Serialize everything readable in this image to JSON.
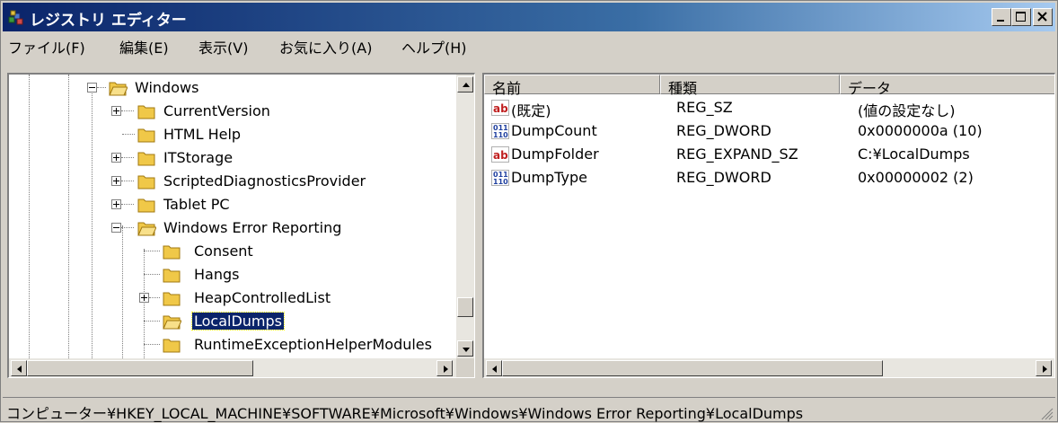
{
  "window": {
    "title": "レジストリ エディター"
  },
  "menu": [
    "ファイル(F)",
    "編集(E)",
    "表示(V)",
    "お気に入り(A)",
    "ヘルプ(H)"
  ],
  "tree": {
    "items": [
      {
        "label": "Windows",
        "expander": "minus"
      },
      {
        "label": "CurrentVersion",
        "expander": "plus"
      },
      {
        "label": "HTML Help",
        "expander": "none"
      },
      {
        "label": "ITStorage",
        "expander": "plus"
      },
      {
        "label": "ScriptedDiagnosticsProvider",
        "expander": "plus"
      },
      {
        "label": "Tablet PC",
        "expander": "plus"
      },
      {
        "label": "Windows Error Reporting",
        "expander": "minus"
      },
      {
        "label": "Consent",
        "expander": "none"
      },
      {
        "label": "Hangs",
        "expander": "none"
      },
      {
        "label": "HeapControlledList",
        "expander": "plus"
      },
      {
        "label": "LocalDumps",
        "expander": "none",
        "selected": true
      },
      {
        "label": "RuntimeExceptionHelperModules",
        "expander": "none"
      }
    ]
  },
  "list": {
    "columns": [
      "名前",
      "種類",
      "データ"
    ],
    "rows": [
      {
        "icon": "string-value-icon",
        "name": "(既定)",
        "type": "REG_SZ",
        "data": "(値の設定なし)"
      },
      {
        "icon": "binary-value-icon",
        "name": "DumpCount",
        "type": "REG_DWORD",
        "data": "0x0000000a (10)"
      },
      {
        "icon": "string-value-icon",
        "name": "DumpFolder",
        "type": "REG_EXPAND_SZ",
        "data": "C:¥LocalDumps"
      },
      {
        "icon": "binary-value-icon",
        "name": "DumpType",
        "type": "REG_DWORD",
        "data": "0x00000002 (2)"
      }
    ]
  },
  "status": {
    "path": "コンピューター¥HKEY_LOCAL_MACHINE¥SOFTWARE¥Microsoft¥Windows¥Windows Error Reporting¥LocalDumps"
  },
  "colors": {
    "title_start": "#0a246a",
    "title_end": "#a6caf0",
    "selection": "#0a246a",
    "chrome": "#d4d0c8"
  }
}
